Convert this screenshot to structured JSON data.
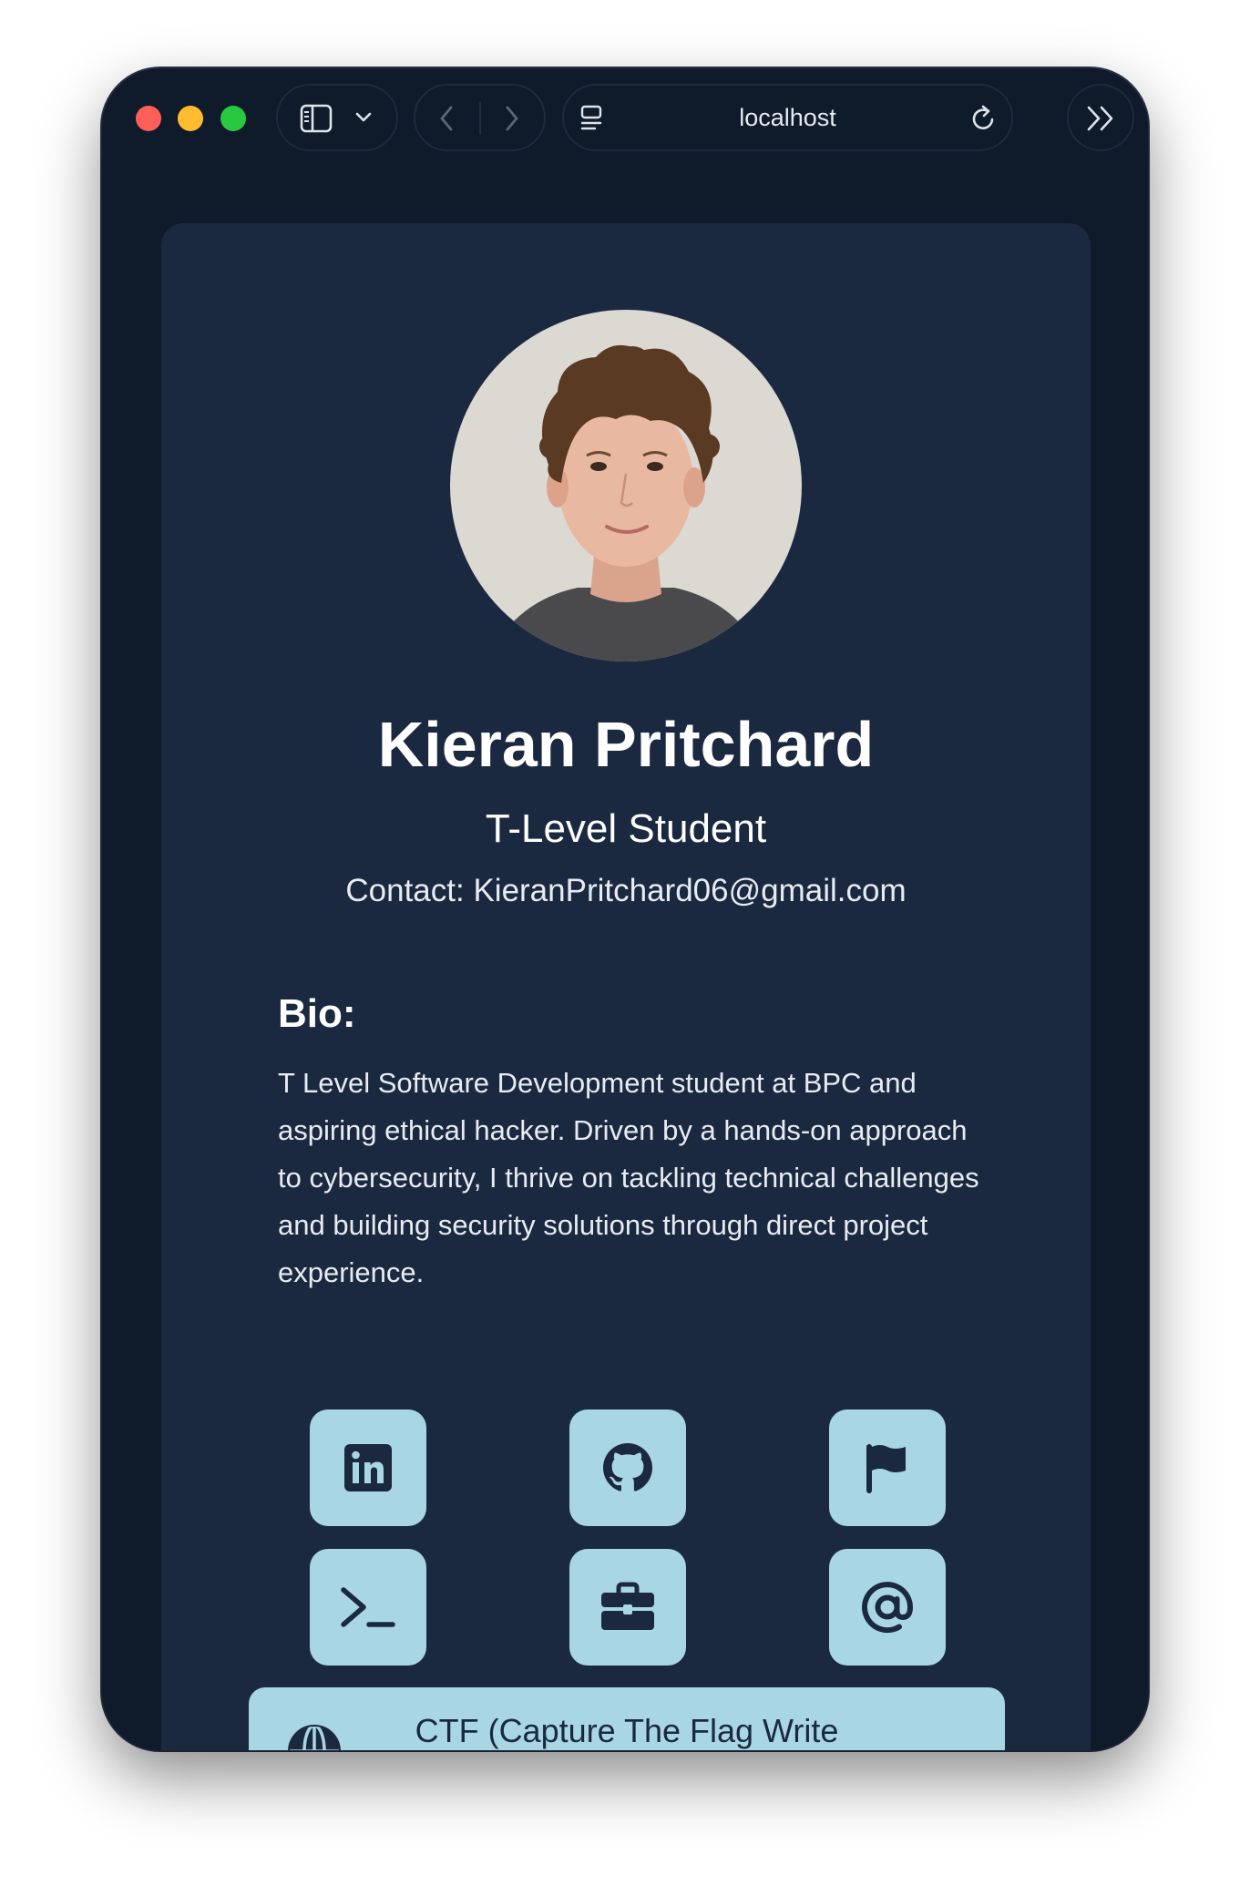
{
  "browser": {
    "url": "localhost",
    "icons": {
      "sidebar": "sidebar-icon",
      "dropdown": "chevron-down-icon",
      "back": "chevron-left-icon",
      "forward": "chevron-right-icon",
      "page_menu": "page-menu-icon",
      "reload": "reload-icon",
      "more": "double-chevron-right-icon"
    }
  },
  "profile": {
    "name": "Kieran Pritchard",
    "role": "T-Level Student",
    "contact": "Contact: KieranPritchard06@gmail.com"
  },
  "bio": {
    "title": "Bio:",
    "text": "T Level Software Development student at BPC and aspiring ethical hacker. Driven by a hands-on approach to cybersecurity, I thrive on tackling technical challenges and building security solutions through direct project experience."
  },
  "links": [
    {
      "icon": "linkedin-icon"
    },
    {
      "icon": "github-icon"
    },
    {
      "icon": "flag-icon"
    },
    {
      "icon": "terminal-icon"
    },
    {
      "icon": "briefcase-icon"
    },
    {
      "icon": "at-sign-icon"
    }
  ],
  "ctf_button": {
    "label": "CTF (Capture The Flag Write Ups)",
    "icon": "globe-icon"
  },
  "colors": {
    "window_bg": "#0f1a2b",
    "card_bg": "#1b2940",
    "button_bg": "#a9d6e5",
    "icon_color": "#1b2940",
    "text": "#ffffff"
  }
}
